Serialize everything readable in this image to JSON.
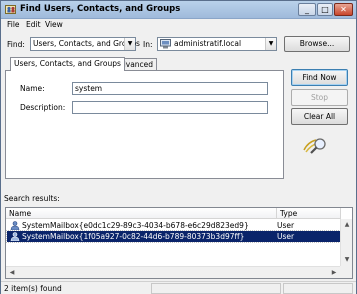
{
  "window": {
    "title": "Find Users, Contacts, and Groups",
    "minimize": "_",
    "maximize": "□",
    "close": "✕"
  },
  "menu": [
    "File",
    "Edit",
    "View"
  ],
  "find": {
    "find_label": "Find:",
    "find_value": "Users, Contacts, and Groups",
    "in_label": "In:",
    "in_value": "administratif.local",
    "browse_label": "Browse..."
  },
  "tabs": [
    {
      "label": "Users, Contacts, and Groups",
      "active": true
    },
    {
      "label": "Advanced",
      "active": false
    }
  ],
  "form": {
    "name_label": "Name:",
    "name_value": "system",
    "description_label": "Description:",
    "description_value": ""
  },
  "buttons": {
    "find_now": "Find Now",
    "stop": "Stop",
    "clear_all": "Clear All"
  },
  "results": {
    "label": "Search results:",
    "columns": [
      "Name",
      "Type"
    ],
    "rows": [
      {
        "name": "SystemMailbox{e0dc1c29-89c3-4034-b678-e6c29d823ed9}",
        "type": "User",
        "selected": false
      },
      {
        "name": "SystemMailbox{1f05a927-0c82-44d6-b789-80373b3d97ff}",
        "type": "User",
        "selected": true
      }
    ]
  },
  "status": {
    "text": "2 item(s) found"
  },
  "colors": {
    "selection": "#0a246a",
    "titlebar": "#b9d1ea"
  }
}
